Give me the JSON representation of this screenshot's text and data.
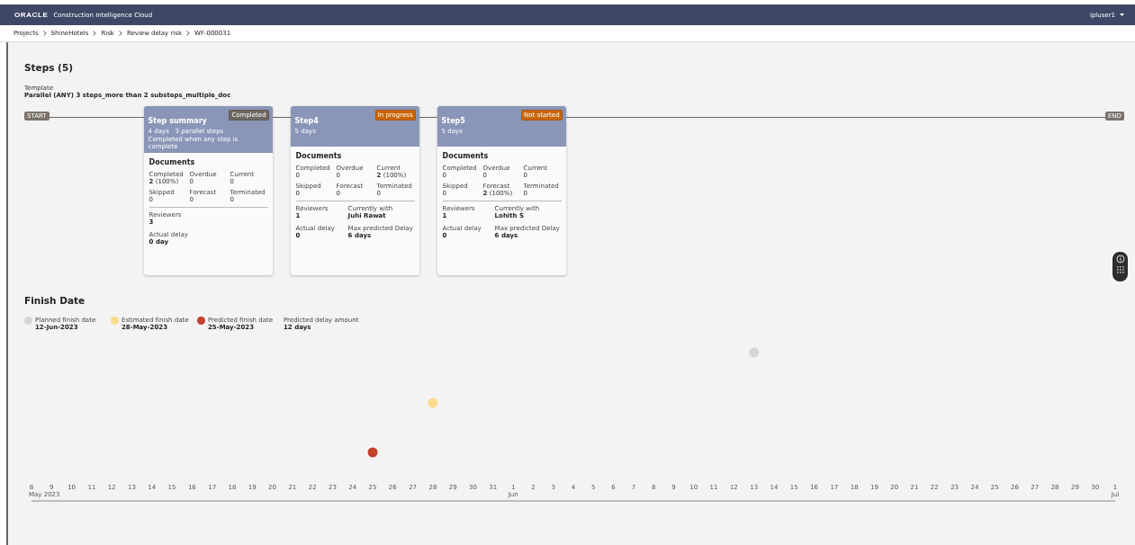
{
  "header": {
    "brand": "ORACLE",
    "product": "Construction Intelligence Cloud",
    "user": "ipluser1"
  },
  "breadcrumb": [
    "Projects",
    "ShineHotels",
    "Risk",
    "Review delay risk",
    "WF-000031"
  ],
  "steps": {
    "title": "Steps (5)",
    "template_label": "Template",
    "template": "Parallel (ANY) 3 steps_more than 2 substeps_multiple_doc",
    "start": "START",
    "end": "END",
    "cards": [
      {
        "title": "Step summary",
        "meta": [
          "4 days   3 parallel steps",
          "Completed when any step is complete"
        ],
        "status": {
          "label": "Completed",
          "kind": "completed"
        },
        "documents_title": "Documents",
        "stats": [
          {
            "label": "Completed",
            "value": "**2** (100%)"
          },
          {
            "label": "Overdue",
            "value": "0"
          },
          {
            "label": "Current",
            "value": "0"
          },
          {
            "label": "Skipped",
            "value": "0"
          },
          {
            "label": "Forecast",
            "value": "0"
          },
          {
            "label": "Terminated",
            "value": "0"
          }
        ],
        "rows": [
          [
            {
              "label": "Reviewers",
              "value": "3"
            }
          ],
          [
            {
              "label": "Actual delay",
              "value": "0 day"
            }
          ]
        ]
      },
      {
        "title": "Step4",
        "meta": [
          "5 days"
        ],
        "status": {
          "label": "In progress",
          "kind": "in_progress"
        },
        "documents_title": "Documents",
        "stats": [
          {
            "label": "Completed",
            "value": "0"
          },
          {
            "label": "Overdue",
            "value": "0"
          },
          {
            "label": "Current",
            "value": "**2** (100%)"
          },
          {
            "label": "Skipped",
            "value": "0"
          },
          {
            "label": "Forecast",
            "value": "0"
          },
          {
            "label": "Terminated",
            "value": "0"
          }
        ],
        "rows": [
          [
            {
              "label": "Reviewers",
              "value": "1"
            },
            {
              "label": "Currently with",
              "value": "Juhi Rawat"
            }
          ],
          [
            {
              "label": "Actual delay",
              "value": "0"
            },
            {
              "label": "Max predicted Delay",
              "value": "6 days"
            }
          ]
        ]
      },
      {
        "title": "Step5",
        "meta": [
          "5 days"
        ],
        "status": {
          "label": "Not started",
          "kind": "not_started"
        },
        "documents_title": "Documents",
        "stats": [
          {
            "label": "Completed",
            "value": "0"
          },
          {
            "label": "Overdue",
            "value": "0"
          },
          {
            "label": "Current",
            "value": "0"
          },
          {
            "label": "Skipped",
            "value": "0"
          },
          {
            "label": "Forecast",
            "value": "**2** (100%)"
          },
          {
            "label": "Terminated",
            "value": "0"
          }
        ],
        "rows": [
          [
            {
              "label": "Reviewers",
              "value": "1"
            },
            {
              "label": "Currently with",
              "value": "Lohith S"
            }
          ],
          [
            {
              "label": "Actual delay",
              "value": "0"
            },
            {
              "label": "Max predicted Delay",
              "value": "6 days"
            }
          ]
        ]
      }
    ]
  },
  "finish_date": {
    "title": "Finish Date",
    "legend": [
      {
        "kind": "planned",
        "label": "Planned finish date",
        "value": "12-Jun-2023",
        "color": "#d6d6d6"
      },
      {
        "kind": "estimated",
        "label": "Estimated finish date",
        "value": "28-May-2023",
        "color": "#fcd98c"
      },
      {
        "kind": "predicted",
        "label": "Predicted finish date",
        "value": "25-May-2023",
        "color": "#c5402d"
      },
      {
        "kind": "delay",
        "label": "Predicted delay amount",
        "value": "12 days"
      }
    ],
    "timeline": [
      {
        "label": "8",
        "month": "May 2023"
      },
      {
        "label": "9"
      },
      {
        "label": "10"
      },
      {
        "label": "11"
      },
      {
        "label": "12"
      },
      {
        "label": "13"
      },
      {
        "label": "14"
      },
      {
        "label": "15"
      },
      {
        "label": "16"
      },
      {
        "label": "17"
      },
      {
        "label": "18"
      },
      {
        "label": "19"
      },
      {
        "label": "20"
      },
      {
        "label": "21"
      },
      {
        "label": "22"
      },
      {
        "label": "23"
      },
      {
        "label": "24"
      },
      {
        "label": "25",
        "kind": "predicted"
      },
      {
        "label": "26"
      },
      {
        "label": "27"
      },
      {
        "label": "28",
        "kind": "estimated"
      },
      {
        "label": "29"
      },
      {
        "label": "30"
      },
      {
        "label": "31"
      },
      {
        "label": "1",
        "month": "Jun"
      },
      {
        "label": "2"
      },
      {
        "label": "3"
      },
      {
        "label": "4"
      },
      {
        "label": "5"
      },
      {
        "label": "6"
      },
      {
        "label": "7"
      },
      {
        "label": "8"
      },
      {
        "label": "9"
      },
      {
        "label": "10"
      },
      {
        "label": "11"
      },
      {
        "label": "12"
      },
      {
        "label": "13",
        "kind": "planned"
      },
      {
        "label": "14"
      },
      {
        "label": "15"
      },
      {
        "label": "16"
      },
      {
        "label": "17"
      },
      {
        "label": "18"
      },
      {
        "label": "19"
      },
      {
        "label": "20"
      },
      {
        "label": "21"
      },
      {
        "label": "22"
      },
      {
        "label": "23"
      },
      {
        "label": "24"
      },
      {
        "label": "25"
      },
      {
        "label": "26"
      },
      {
        "label": "27"
      },
      {
        "label": "28"
      },
      {
        "label": "29"
      },
      {
        "label": "30"
      },
      {
        "label": "1",
        "month": "Jul"
      }
    ]
  }
}
